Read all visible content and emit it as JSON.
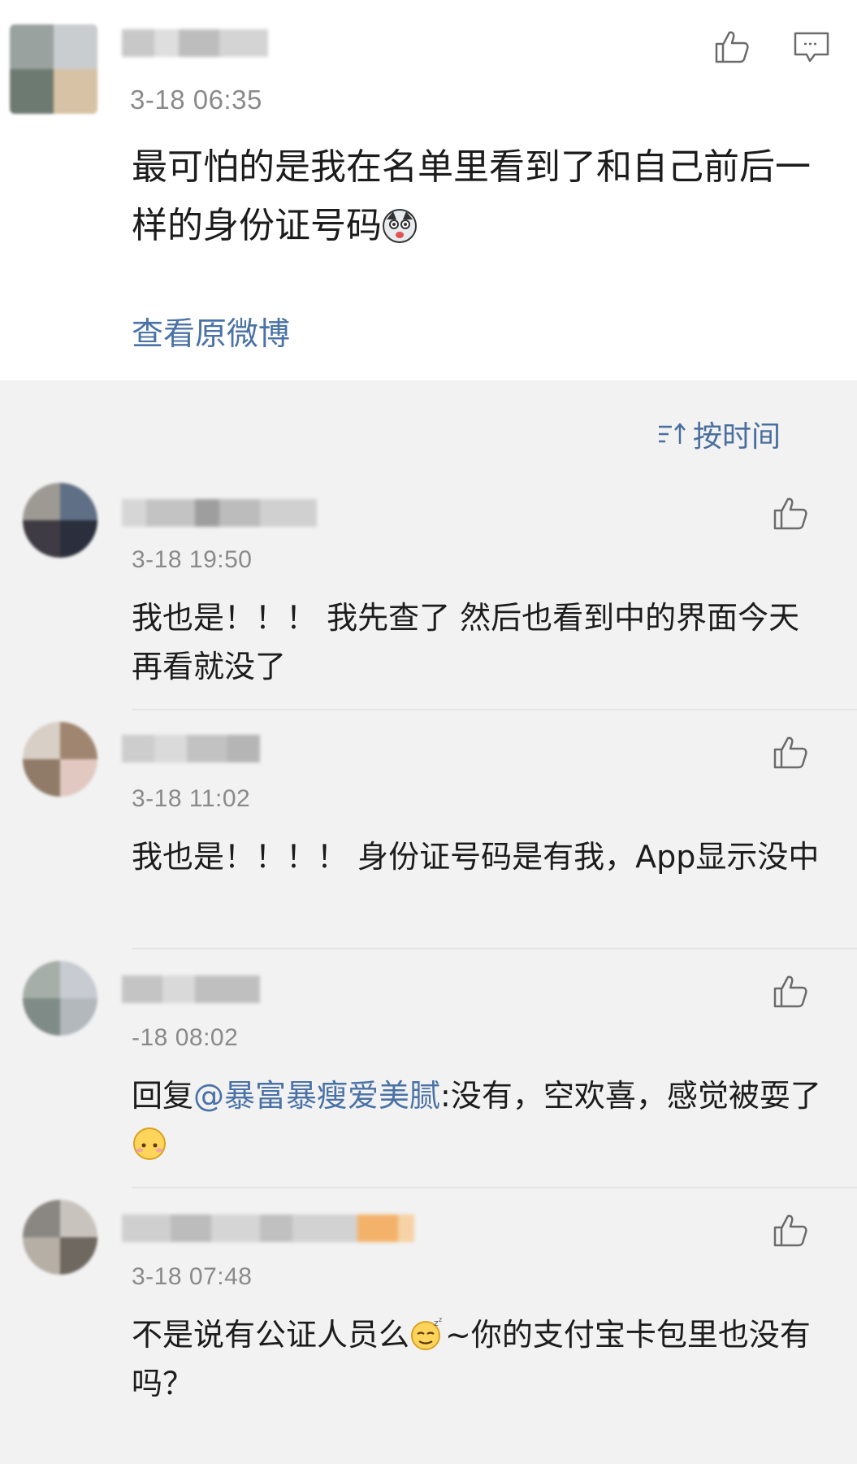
{
  "post": {
    "timestamp": "3-18 06:35",
    "text": "最可怕的是我在名单里看到了和自己前后一样的身份证号码",
    "emoji_icon": "husky-emoji-icon",
    "view_original": "查看原微博",
    "like_icon": "thumbs-up-icon",
    "comment_icon": "comment-icon"
  },
  "sort": {
    "label": "按时间",
    "icon": "sort-icon"
  },
  "comments": [
    {
      "timestamp": "3-18 19:50",
      "text": "我也是！！！ 我先查了 然后也看到中的界面今天再看就没了"
    },
    {
      "timestamp": "3-18 11:02",
      "text": "我也是！！！！ 身份证号码是有我，App显示没中"
    },
    {
      "timestamp": "-18 08:02",
      "prefix": "回复",
      "mention": "@暴富暴瘦爱美腻",
      "text": ":没有，空欢喜，感觉被耍了",
      "emoji_icon": "blank-face-emoji-icon"
    },
    {
      "timestamp": "3-18 07:48",
      "text_before": "不是说有公证人员么",
      "text_after": "~你的支付宝卡包里也没有吗？",
      "emoji_icon": "sleepy-emoji-icon"
    }
  ],
  "colors": {
    "link": "#4a72a6",
    "timestamp": "#8a8a8a",
    "background": "#f2f2f2"
  }
}
